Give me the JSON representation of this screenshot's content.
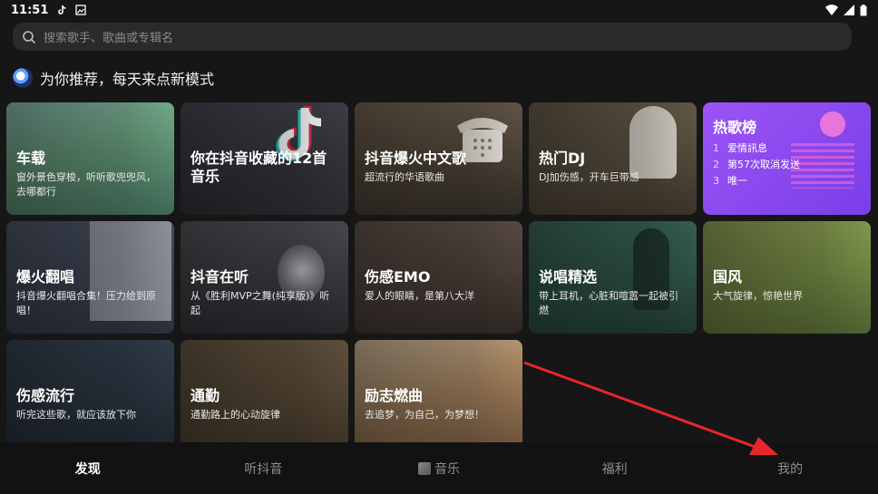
{
  "status": {
    "time": "11:51"
  },
  "search": {
    "placeholder": "搜索歌手、歌曲或专辑名"
  },
  "section": {
    "title": "为你推荐，每天来点新模式"
  },
  "cards": [
    {
      "title": "车载",
      "sub": "窗外景色穿梭，听听歌兜兜风，去哪都行",
      "bg": "#6b9a7a"
    },
    {
      "title": "你在抖音收藏的12首音乐",
      "sub": "",
      "bg": "#3a3a44"
    },
    {
      "title": "抖音爆火中文歌",
      "sub": "超流行的华语歌曲",
      "bg": "#5a4a3c"
    },
    {
      "title": "热门DJ",
      "sub": "DJ加伤感，开车巨带感",
      "bg": "#6a5c46"
    },
    {
      "title": "热歌榜",
      "rows": [
        {
          "n": "1",
          "t": "爱情訊息"
        },
        {
          "n": "2",
          "t": "第57次取消发送"
        },
        {
          "n": "3",
          "t": "唯一"
        }
      ],
      "bg": "#8d4cf0"
    },
    {
      "title": "爆火翻唱",
      "sub": "抖音爆火翻唱合集！压力给到原唱！",
      "bg": "#3c4654"
    },
    {
      "title": "抖音在听",
      "sub": "从《胜利MVP之舞(纯享版)》听起",
      "bg": "#3f4046"
    },
    {
      "title": "伤感EMO",
      "sub": "爱人的眼睛，是第八大洋",
      "bg": "#4a3f3a"
    },
    {
      "title": "说唱精选",
      "sub": "带上耳机，心脏和喧嚣一起被引燃",
      "bg": "#2f5448"
    },
    {
      "title": "国风",
      "sub": "大气旋律，惊艳世界",
      "bg": "#6b8444"
    },
    {
      "title": "伤感流行",
      "sub": "听完这些歌，就应该放下你",
      "bg": "#2e3844"
    },
    {
      "title": "通勤",
      "sub": "通勤路上的心动旋律",
      "bg": "#5a4a36"
    },
    {
      "title": "励志燃曲",
      "sub": "去追梦，为自己，为梦想！",
      "bg": "#8a6a4c"
    }
  ],
  "nav": {
    "discover": "发现",
    "listen": "听抖音",
    "music": "音乐",
    "welfare": "福利",
    "mine": "我的"
  },
  "colors": {
    "accent_arrow": "#e8262a",
    "hot_card": "#8d4cf0"
  }
}
